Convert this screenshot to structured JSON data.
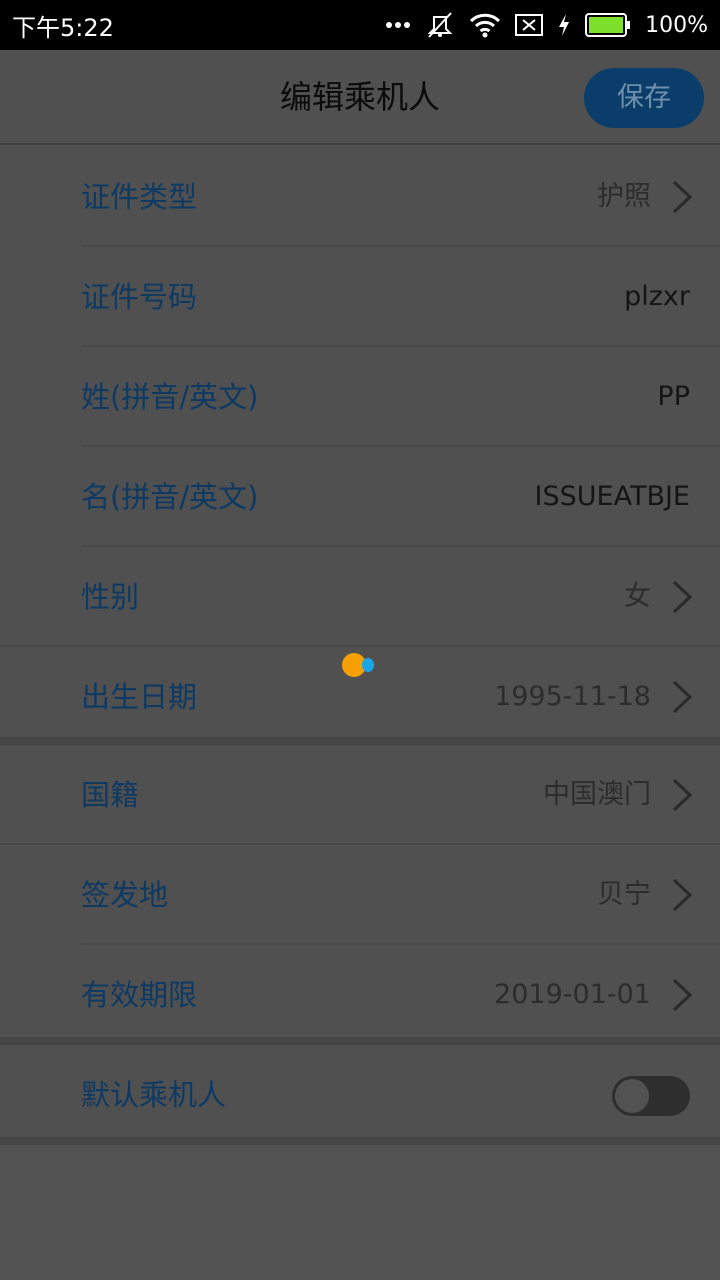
{
  "status_bar": {
    "time": "下午5:22",
    "battery": "100%",
    "battery_color": "#7ee02a"
  },
  "header": {
    "title": "编辑乘机人",
    "save_label": "保存"
  },
  "form": {
    "section1": [
      {
        "label": "证件类型",
        "value": "护照"
      },
      {
        "label": "证件号码",
        "value": "plzxr"
      },
      {
        "label": "姓(拼音/英文)",
        "value": "PP"
      },
      {
        "label": "名(拼音/英文)",
        "value": "ISSUEATBJE"
      },
      {
        "label": "性别",
        "value": "女"
      },
      {
        "label": "出生日期",
        "value": "1995-11-18"
      }
    ],
    "section2": [
      {
        "label": "国籍",
        "value": "中国澳门"
      },
      {
        "label": "签发地",
        "value": "贝宁"
      },
      {
        "label": "有效期限",
        "value": "2019-01-01"
      }
    ],
    "section3": {
      "label": "默认乘机人",
      "toggle_on": false
    }
  },
  "colors": {
    "accent_blue": "#0a3d6a",
    "label_blue": "#0d3963"
  },
  "icons": [
    "chevron-right-icon",
    "wifi-icon",
    "mute-icon",
    "sim-icon",
    "battery-icon",
    "charging-icon",
    "more-icon"
  ]
}
